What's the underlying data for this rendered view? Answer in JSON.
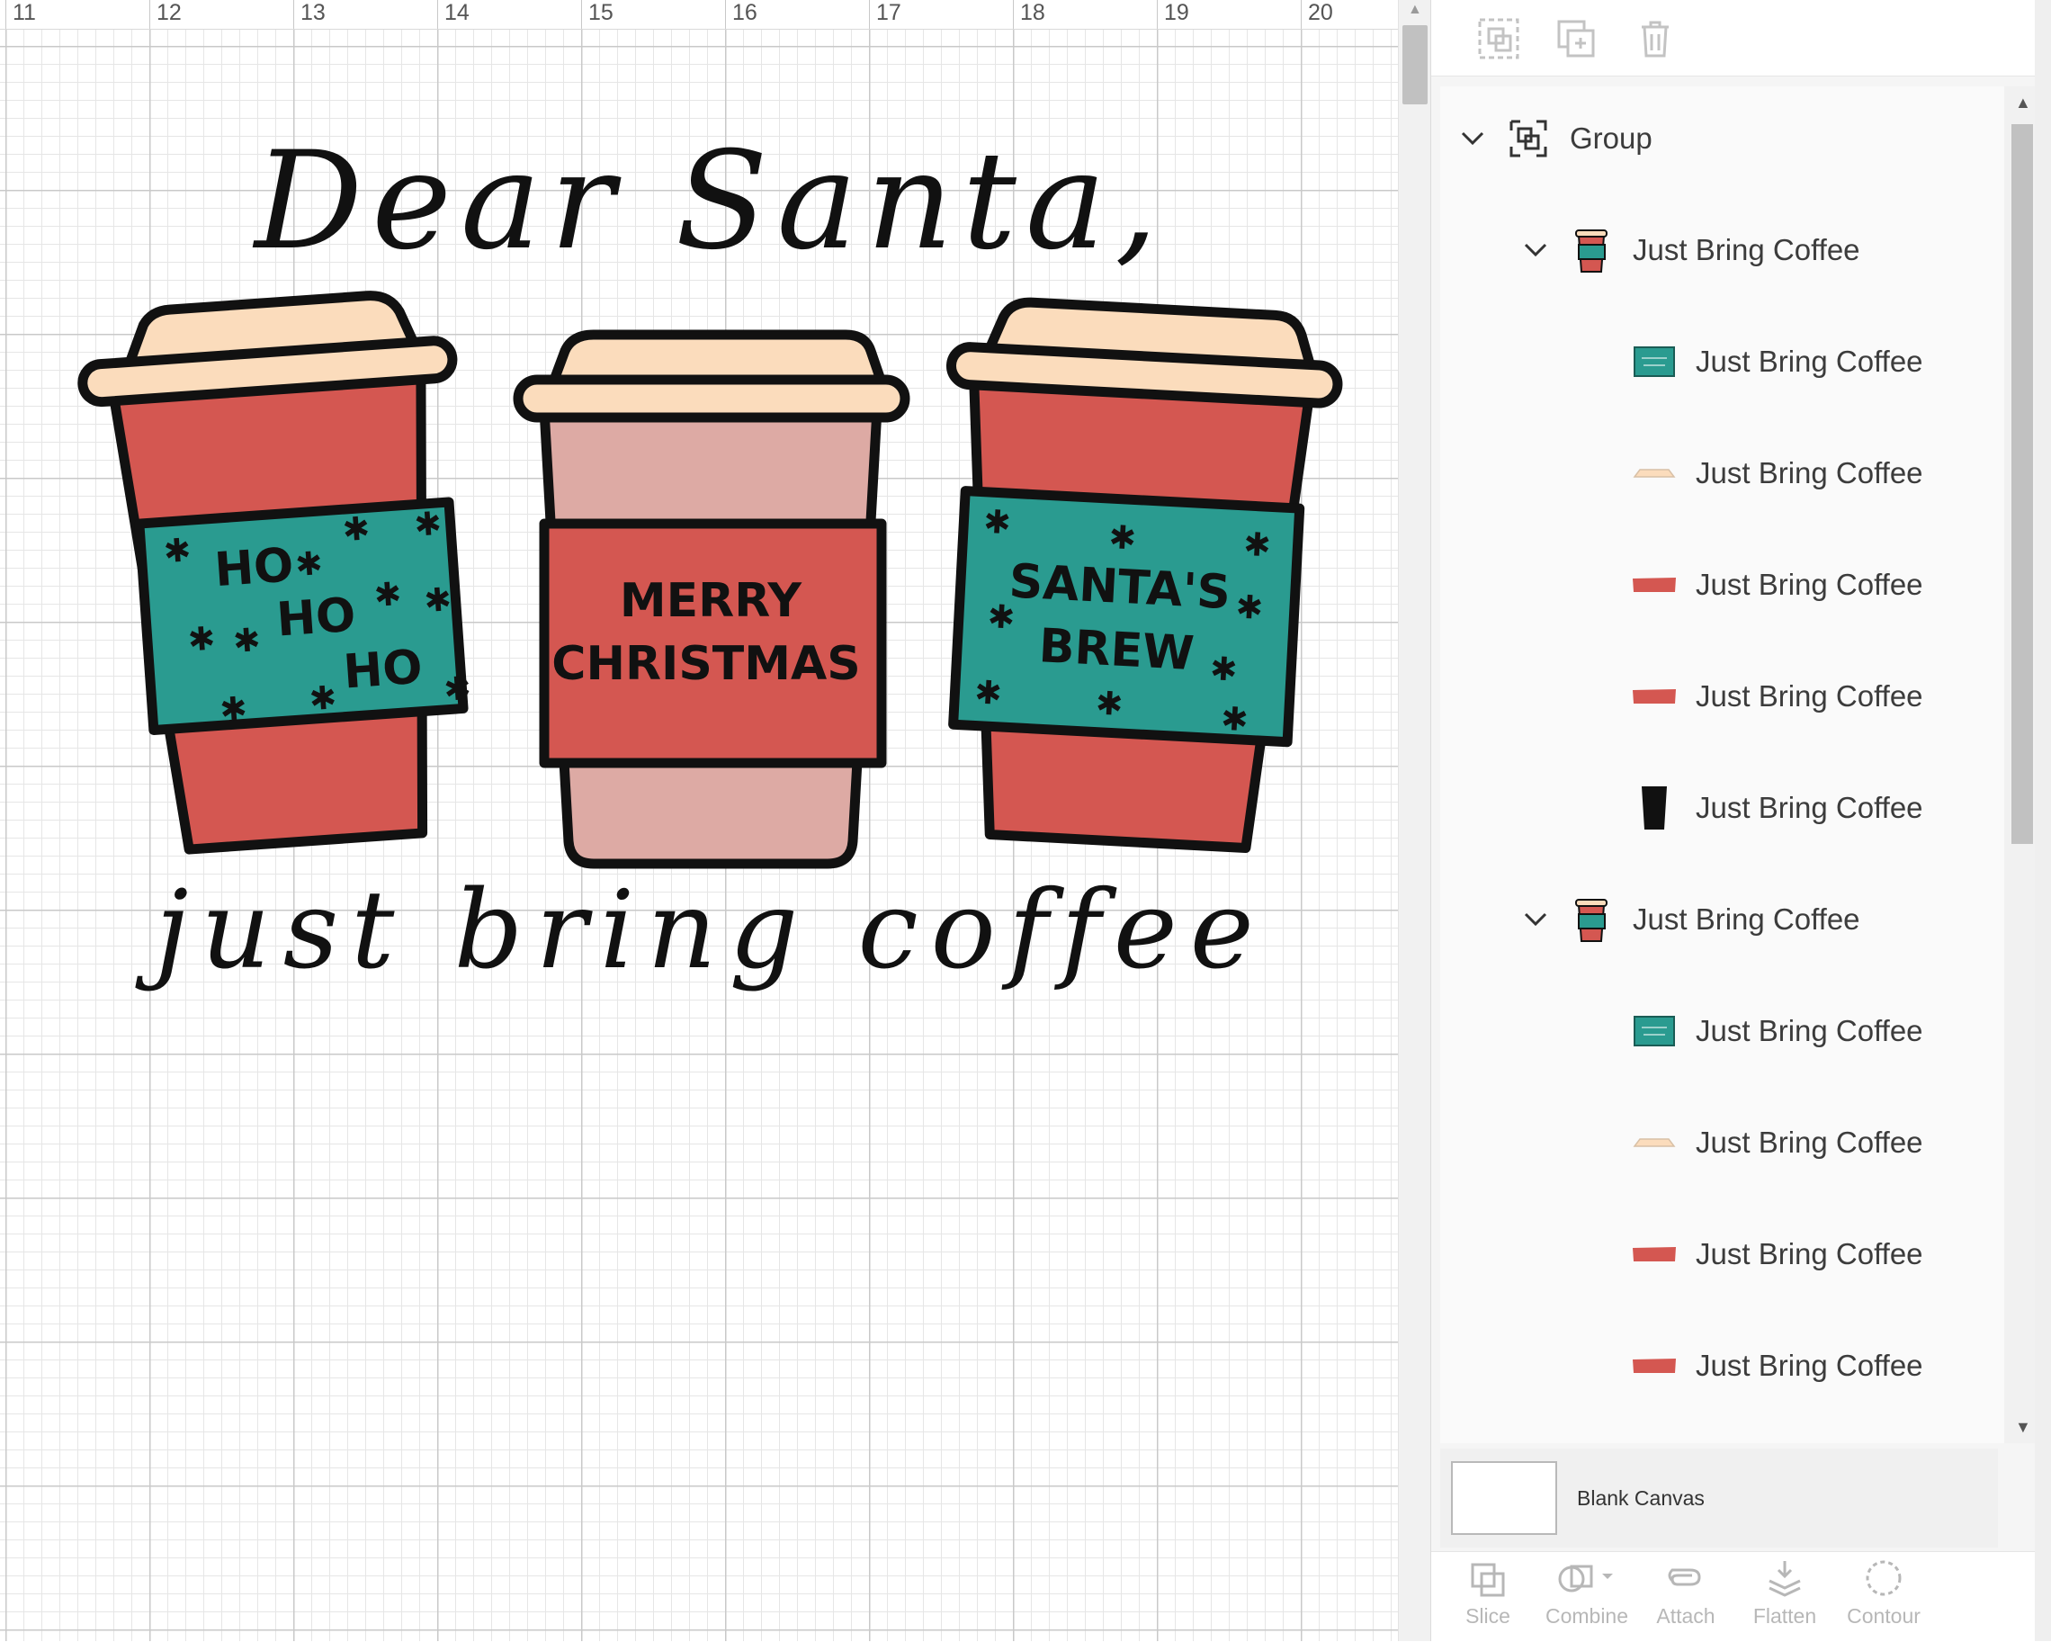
{
  "ruler": {
    "labels": [
      "11",
      "12",
      "13",
      "14",
      "15",
      "16",
      "17",
      "18",
      "19",
      "20"
    ]
  },
  "artwork": {
    "title_script": "Dear Santa,",
    "tagline_script": "just bring coffee",
    "cup_left_sleeve": [
      "HO",
      "HO",
      "HO"
    ],
    "cup_middle_sleeve": [
      "MERRY",
      "CHRISTMAS"
    ],
    "cup_right_sleeve": [
      "SANTA'S",
      "BREW"
    ]
  },
  "layers": {
    "group_label": "Group",
    "rows": [
      {
        "label": "Just Bring Coffee",
        "kind": "subgroup",
        "thumb": "cup-icon"
      },
      {
        "label": "Just Bring Coffee",
        "kind": "layer",
        "thumb": "teal-sleeve-icon"
      },
      {
        "label": "Just Bring Coffee",
        "kind": "layer",
        "thumb": "cream-lid-icon"
      },
      {
        "label": "Just Bring Coffee",
        "kind": "layer",
        "thumb": "red-band-icon"
      },
      {
        "label": "Just Bring Coffee",
        "kind": "layer",
        "thumb": "red-band-icon"
      },
      {
        "label": "Just Bring Coffee",
        "kind": "layer",
        "thumb": "black-cup-icon"
      },
      {
        "label": "Just Bring Coffee",
        "kind": "subgroup",
        "thumb": "cup-icon"
      },
      {
        "label": "Just Bring Coffee",
        "kind": "layer",
        "thumb": "teal-sleeve-icon"
      },
      {
        "label": "Just Bring Coffee",
        "kind": "layer",
        "thumb": "cream-lid-icon"
      },
      {
        "label": "Just Bring Coffee",
        "kind": "layer",
        "thumb": "red-band-icon"
      },
      {
        "label": "Just Bring Coffee",
        "kind": "layer",
        "thumb": "red-band-icon"
      }
    ]
  },
  "blank_canvas_label": "Blank Canvas",
  "bottom_toolbar": {
    "slice": "Slice",
    "combine": "Combine",
    "attach": "Attach",
    "flatten": "Flatten",
    "contour": "Contour"
  },
  "colors": {
    "cup_red": "#d45751",
    "cup_pink": "#ddaaa4",
    "lid_cream": "#fbdcbc",
    "sleeve_teal": "#2a9b90",
    "outline": "#111111"
  }
}
